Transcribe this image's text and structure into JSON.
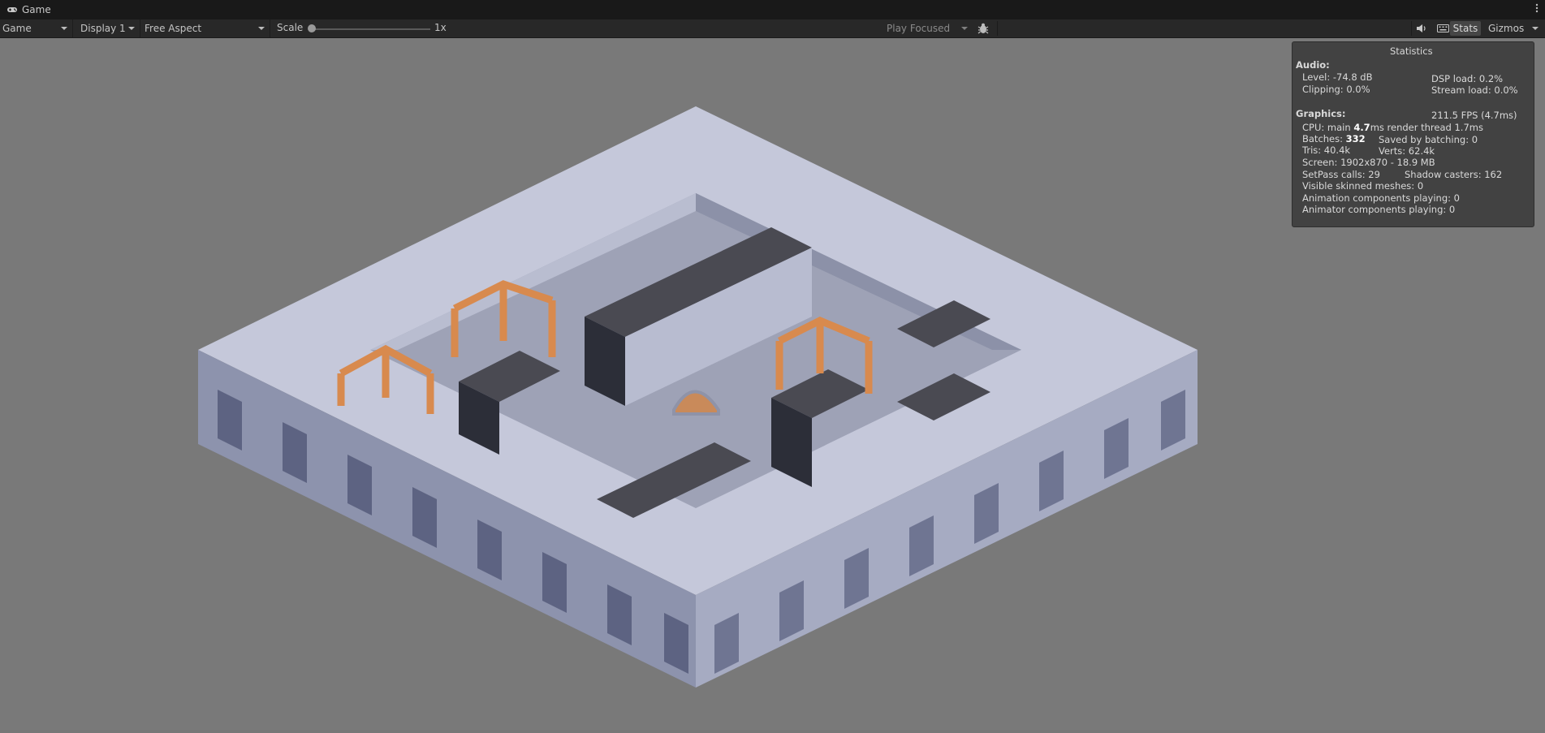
{
  "window": {
    "tab_title": "Game",
    "tab_icon": "gamepad-icon",
    "menu_icon": "kebab-menu-icon"
  },
  "toolbar": {
    "mode_label": "Game",
    "display_label": "Display 1",
    "aspect_label": "Free Aspect",
    "scale_label": "Scale",
    "scale_value": "1x",
    "scale_fraction": 0.0,
    "play_mode_label": "Play Focused",
    "bug_icon": "bug-icon",
    "audio_icon": "speaker-icon",
    "keyboard_icon": "keyboard-icon",
    "stats_label": "Stats",
    "gizmos_label": "Gizmos"
  },
  "stats": {
    "title": "Statistics",
    "audio_header": "Audio:",
    "level": "Level: -74.8 dB",
    "clipping": "Clipping: 0.0%",
    "dsp_load": "DSP load: 0.2%",
    "stream_load": "Stream load: 0.0%",
    "graphics_header": "Graphics:",
    "fps": "211.5 FPS (4.7ms)",
    "cpu_main_prefix": "CPU: main ",
    "cpu_main_value": "4.7",
    "cpu_main_suffix": "ms  render thread 1.7ms",
    "batches_prefix": "Batches: ",
    "batches_value": "332",
    "saved_by_batching": "Saved by batching: 0",
    "tris": "Tris: 40.4k",
    "verts": "Verts: 62.4k",
    "screen": "Screen: 1902x870 - 18.9 MB",
    "setpass": "SetPass calls: 29",
    "shadow_casters": "Shadow casters: 162",
    "visible_skinned": "Visible skinned meshes: 0",
    "animation_components": "Animation components playing: 0",
    "animator_components": "Animator components playing: 0"
  },
  "scene": {
    "background_color": "#797979",
    "stone_color": "#c5c8da",
    "roof_color": "#4a4a52",
    "wood_color": "#d88a4e"
  }
}
